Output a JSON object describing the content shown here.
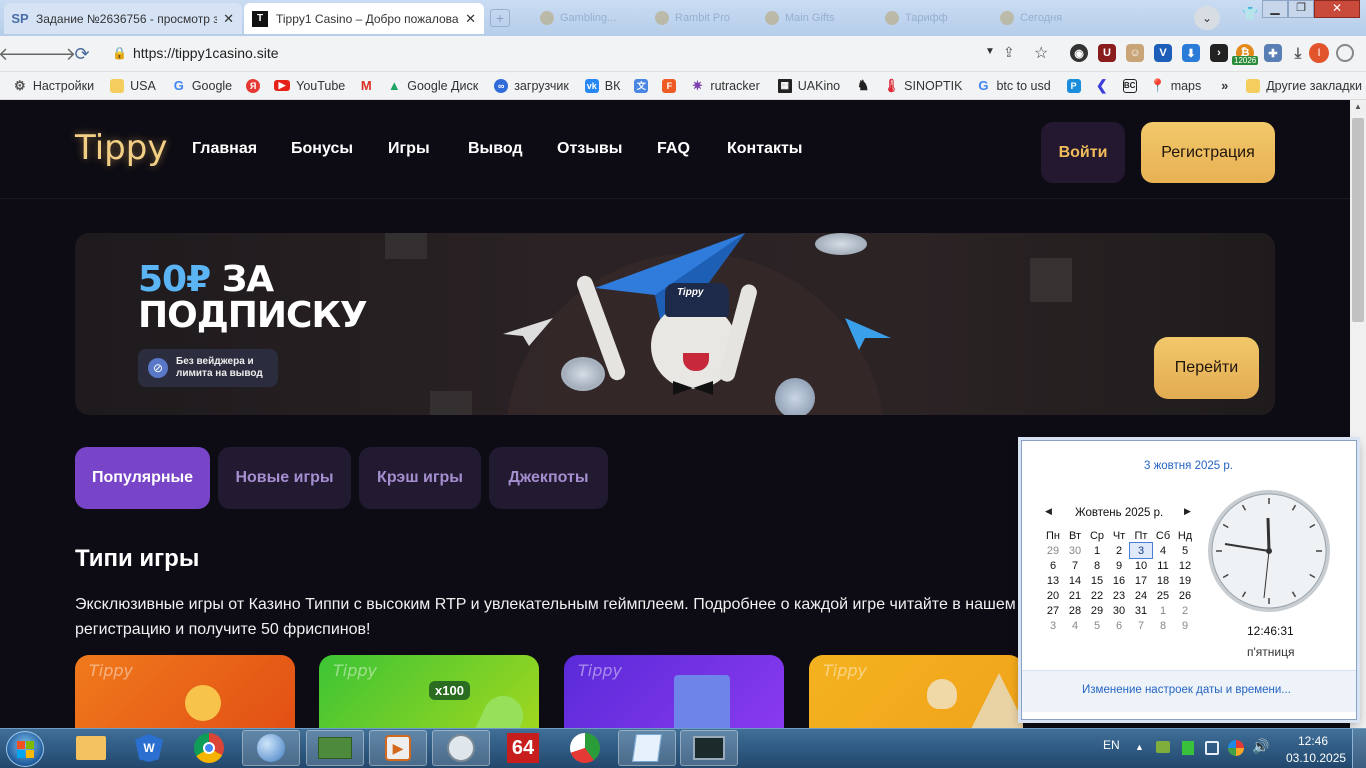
{
  "browser": {
    "tabs": [
      {
        "favicon": "SP",
        "title": "Задание №2636756 - просмотр з"
      },
      {
        "favicon": "T",
        "title": "Tippy1 Casino – Добро пожалова"
      }
    ],
    "ghost_tabs": [
      "Gambling...",
      "Rambit Pro",
      "Main Gifts",
      "Тарифф",
      "Сегодня"
    ],
    "url": "https://tippy1casino.site",
    "extension_badge": "12026",
    "profile_initial": "I",
    "bookmarks": [
      {
        "label": "Настройки",
        "icon": "gear-icon"
      },
      {
        "label": "USA",
        "icon": "folder-icon"
      },
      {
        "label": "Google",
        "icon": "google-icon"
      },
      {
        "label": "",
        "icon": "yandex-icon"
      },
      {
        "label": "YouTube",
        "icon": "youtube-icon"
      },
      {
        "label": "",
        "icon": "gmail-icon"
      },
      {
        "label": "Google Диск",
        "icon": "drive-icon"
      },
      {
        "label": "загрузчик",
        "icon": "link-icon"
      },
      {
        "label": "ВК",
        "icon": "vk-icon"
      },
      {
        "label": "",
        "icon": "translate-icon"
      },
      {
        "label": "",
        "icon": "f-icon"
      },
      {
        "label": "rutracker",
        "icon": "rutracker-icon"
      },
      {
        "label": "UAKino",
        "icon": "uakino-icon"
      },
      {
        "label": "",
        "icon": "chess-icon"
      },
      {
        "label": "SINOPTIK",
        "icon": "thermometer-icon"
      },
      {
        "label": "btc to usd",
        "icon": "google-icon"
      },
      {
        "label": "",
        "icon": "p-icon"
      },
      {
        "label": "",
        "icon": "chevron-icon"
      },
      {
        "label": "",
        "icon": "bc-icon"
      },
      {
        "label": "maps",
        "icon": "maps-icon"
      }
    ],
    "more_bookmarks": "»",
    "other_bookmarks": "Другие закладки"
  },
  "site": {
    "logo": "Tippy",
    "nav": [
      "Главная",
      "Бонусы",
      "Игры",
      "Вывод",
      "Отзывы",
      "FAQ",
      "Контакты"
    ],
    "login": "Войти",
    "register": "Регистрация",
    "banner": {
      "amount": "50₽",
      "title_word1": "ЗА",
      "title_line2": "ПОДПИСКУ",
      "badge_line1": "Без вейджера и",
      "badge_line2": "лимита на вывод",
      "cta": "Перейти",
      "hat_text": "Tippy"
    },
    "categories": [
      "Популярные",
      "Новые игры",
      "Крэш игры",
      "Джекпоты"
    ],
    "section_title": "Типи игры",
    "description": "Эксклюзивные игры от Казино Типпи с высоким RTP и увлекательным геймплеем. Подробнее о каждой игре читайте в нашем к регистрацию и получите 50 фриспинов!",
    "cards": [
      {
        "label": "Tippy",
        "color1": "#f07a1c",
        "color2": "#e14d14"
      },
      {
        "label": "Tippy",
        "color1": "#3cc435",
        "color2": "#a6d81e",
        "badge": "x100"
      },
      {
        "label": "Tippy",
        "color1": "#5a2ad8",
        "color2": "#8c3bf0"
      },
      {
        "label": "Tippy",
        "color1": "#f4b21f",
        "color2": "#f0a31a"
      }
    ]
  },
  "calendar": {
    "date_header": "3 жовтня 2025 р.",
    "month": "Жовтень 2025 р.",
    "weekdays": [
      "Пн",
      "Вт",
      "Ср",
      "Чт",
      "Пт",
      "Сб",
      "Нд"
    ],
    "weeks": [
      [
        "29",
        "30",
        "1",
        "2",
        "3",
        "4",
        "5"
      ],
      [
        "6",
        "7",
        "8",
        "9",
        "10",
        "11",
        "12"
      ],
      [
        "13",
        "14",
        "15",
        "16",
        "17",
        "18",
        "19"
      ],
      [
        "20",
        "21",
        "22",
        "23",
        "24",
        "25",
        "26"
      ],
      [
        "27",
        "28",
        "29",
        "30",
        "31",
        "1",
        "2"
      ],
      [
        "3",
        "4",
        "5",
        "6",
        "7",
        "8",
        "9"
      ]
    ],
    "today": "3",
    "time": "12:46:31",
    "weekday_name": "п'ятниця",
    "settings_link": "Изменение настроек даты и времени..."
  },
  "taskbar": {
    "lang": "EN",
    "clock_time": "12:46",
    "clock_date": "03.10.2025",
    "apps": [
      "explorer",
      "winmedic",
      "chrome",
      "browser",
      "excel-compare",
      "media-player",
      "clock",
      "aida64",
      "chart-app",
      "notepad",
      "terminal"
    ],
    "aida_label": "64"
  }
}
